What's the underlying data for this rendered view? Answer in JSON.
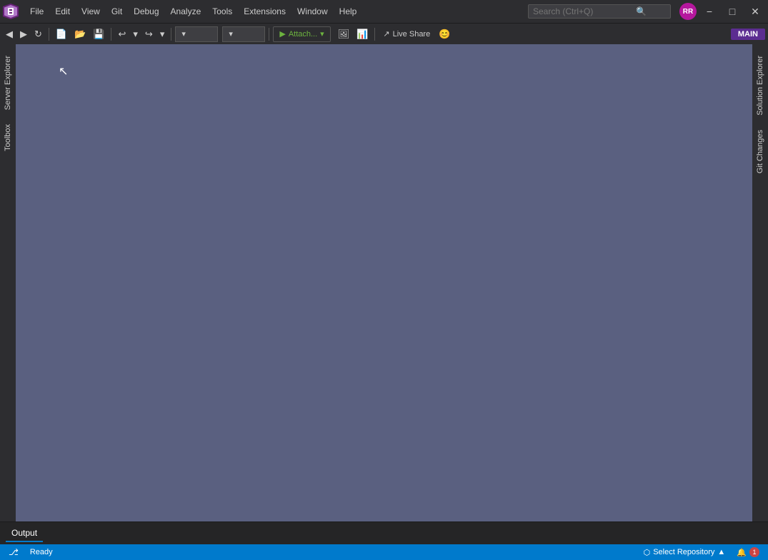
{
  "app": {
    "title": "Visual Studio"
  },
  "menu": {
    "items": [
      "File",
      "Edit",
      "View",
      "Git",
      "Debug",
      "Analyze",
      "Tools",
      "Extensions",
      "Window",
      "Help"
    ]
  },
  "search": {
    "placeholder": "Search (Ctrl+Q)"
  },
  "toolbar": {
    "undo_label": "↩",
    "redo_label": "↪",
    "run_label": "▶ Attach...",
    "liveshare_label": "Live Share",
    "main_label": "MAIN"
  },
  "sidebar_left": {
    "tabs": [
      "Server Explorer",
      "Toolbox"
    ]
  },
  "sidebar_right": {
    "tabs": [
      "Solution Explorer",
      "Git Changes"
    ]
  },
  "output": {
    "tab_label": "Output"
  },
  "status_bar": {
    "ready_label": "Ready",
    "repo_label": "Select Repository",
    "notification_count": "1"
  },
  "user": {
    "initials": "RR"
  }
}
